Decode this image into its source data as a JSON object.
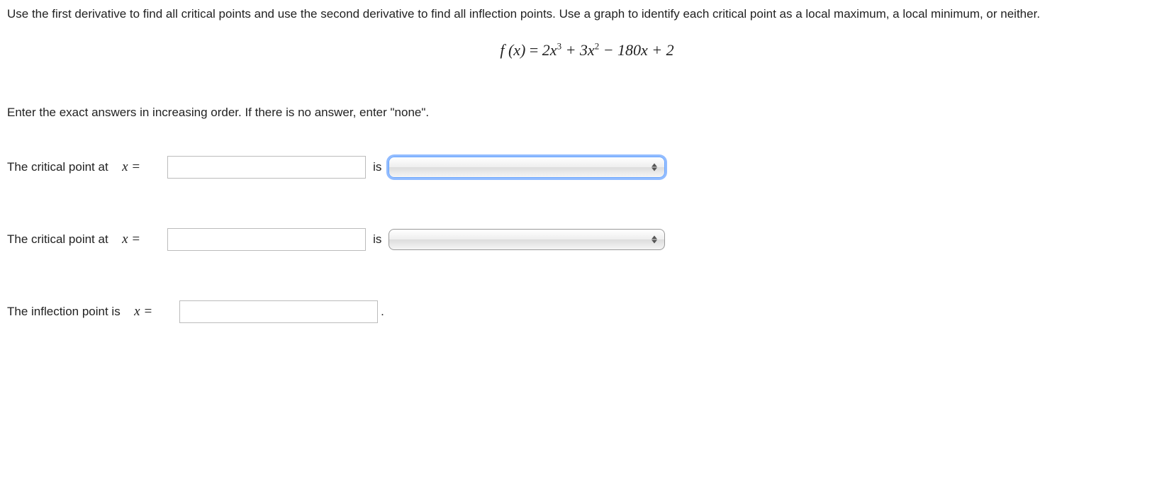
{
  "instructions": "Use the first derivative to find all critical points and use the second derivative to find all inflection points. Use a graph to identify each critical point as a local maximum, a local minimum, or neither.",
  "formula": {
    "lhs": "f (x)",
    "rhs_prefix": "2x",
    "exp1": "3",
    "plus1": " + 3x",
    "exp2": "2",
    "tail": " − 180x + 2"
  },
  "sub_instructions": "Enter the exact answers in increasing order. If there is no answer, enter \"none\".",
  "rows": {
    "cp1": {
      "label": "The critical point at  ",
      "xeq": "x =",
      "value": "",
      "is": "is",
      "select_value": ""
    },
    "cp2": {
      "label": "The critical point at  ",
      "xeq": "x =",
      "value": "",
      "is": "is",
      "select_value": ""
    },
    "ip": {
      "label": "The inflection point is  ",
      "xeq": "x =",
      "value": "",
      "period": "."
    }
  }
}
